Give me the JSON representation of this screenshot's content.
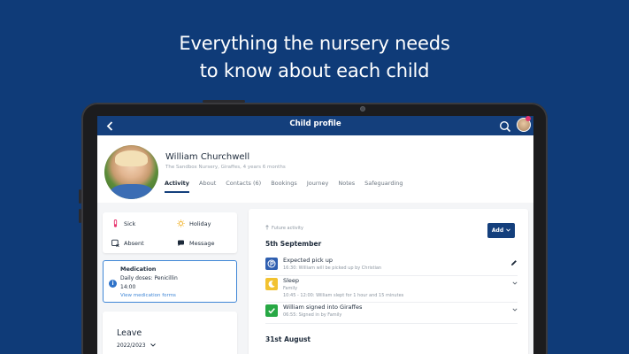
{
  "headline": {
    "line1": "Everything the nursery needs",
    "line2": "to know about each child"
  },
  "appbar": {
    "title": "Child profile",
    "back_icon": "chevron-left-icon",
    "search_icon": "search-icon"
  },
  "profile": {
    "name": "William Churchwell",
    "meta": "The Sandbox Nursery, Giraffes, 4 years 6 months",
    "tabs": [
      {
        "label": "Activity",
        "active": true
      },
      {
        "label": "About"
      },
      {
        "label": "Contacts (6)"
      },
      {
        "label": "Bookings"
      },
      {
        "label": "Journey"
      },
      {
        "label": "Notes"
      },
      {
        "label": "Safeguarding"
      }
    ]
  },
  "quick_actions": {
    "sick": "Sick",
    "holiday": "Holiday",
    "absent": "Absent",
    "message": "Message"
  },
  "medication": {
    "title": "Medication",
    "line1": "Daily doses: Penicillin",
    "line2": "14:00",
    "link": "View medication forms"
  },
  "leave": {
    "title": "Leave",
    "year": "2022/2023"
  },
  "feed": {
    "future_label": "Future activity",
    "add_label": "Add",
    "sections": [
      {
        "date": "5th September",
        "entries": [
          {
            "title": "Expected pick up",
            "detail": "16:30: William will be picked up by Christian",
            "icon": "pickup-icon",
            "color": "#2f5fb0",
            "action": "edit"
          },
          {
            "title": "Sleep",
            "detail_line1": "Family",
            "detail_line2": "10:45 - 12:00: William slept for 1 hour and 15 minutes",
            "icon": "moon-icon",
            "color": "#f2c230",
            "action": "expand"
          },
          {
            "title": "William signed into Giraffes",
            "detail": "06:55: Signed in by Family",
            "icon": "check-icon",
            "color": "#27a844",
            "action": "expand"
          }
        ]
      },
      {
        "date": "31st August"
      }
    ]
  },
  "colors": {
    "background": "#0f3b78",
    "appbar": "#143f7c",
    "accent_blue": "#3f86d6"
  }
}
